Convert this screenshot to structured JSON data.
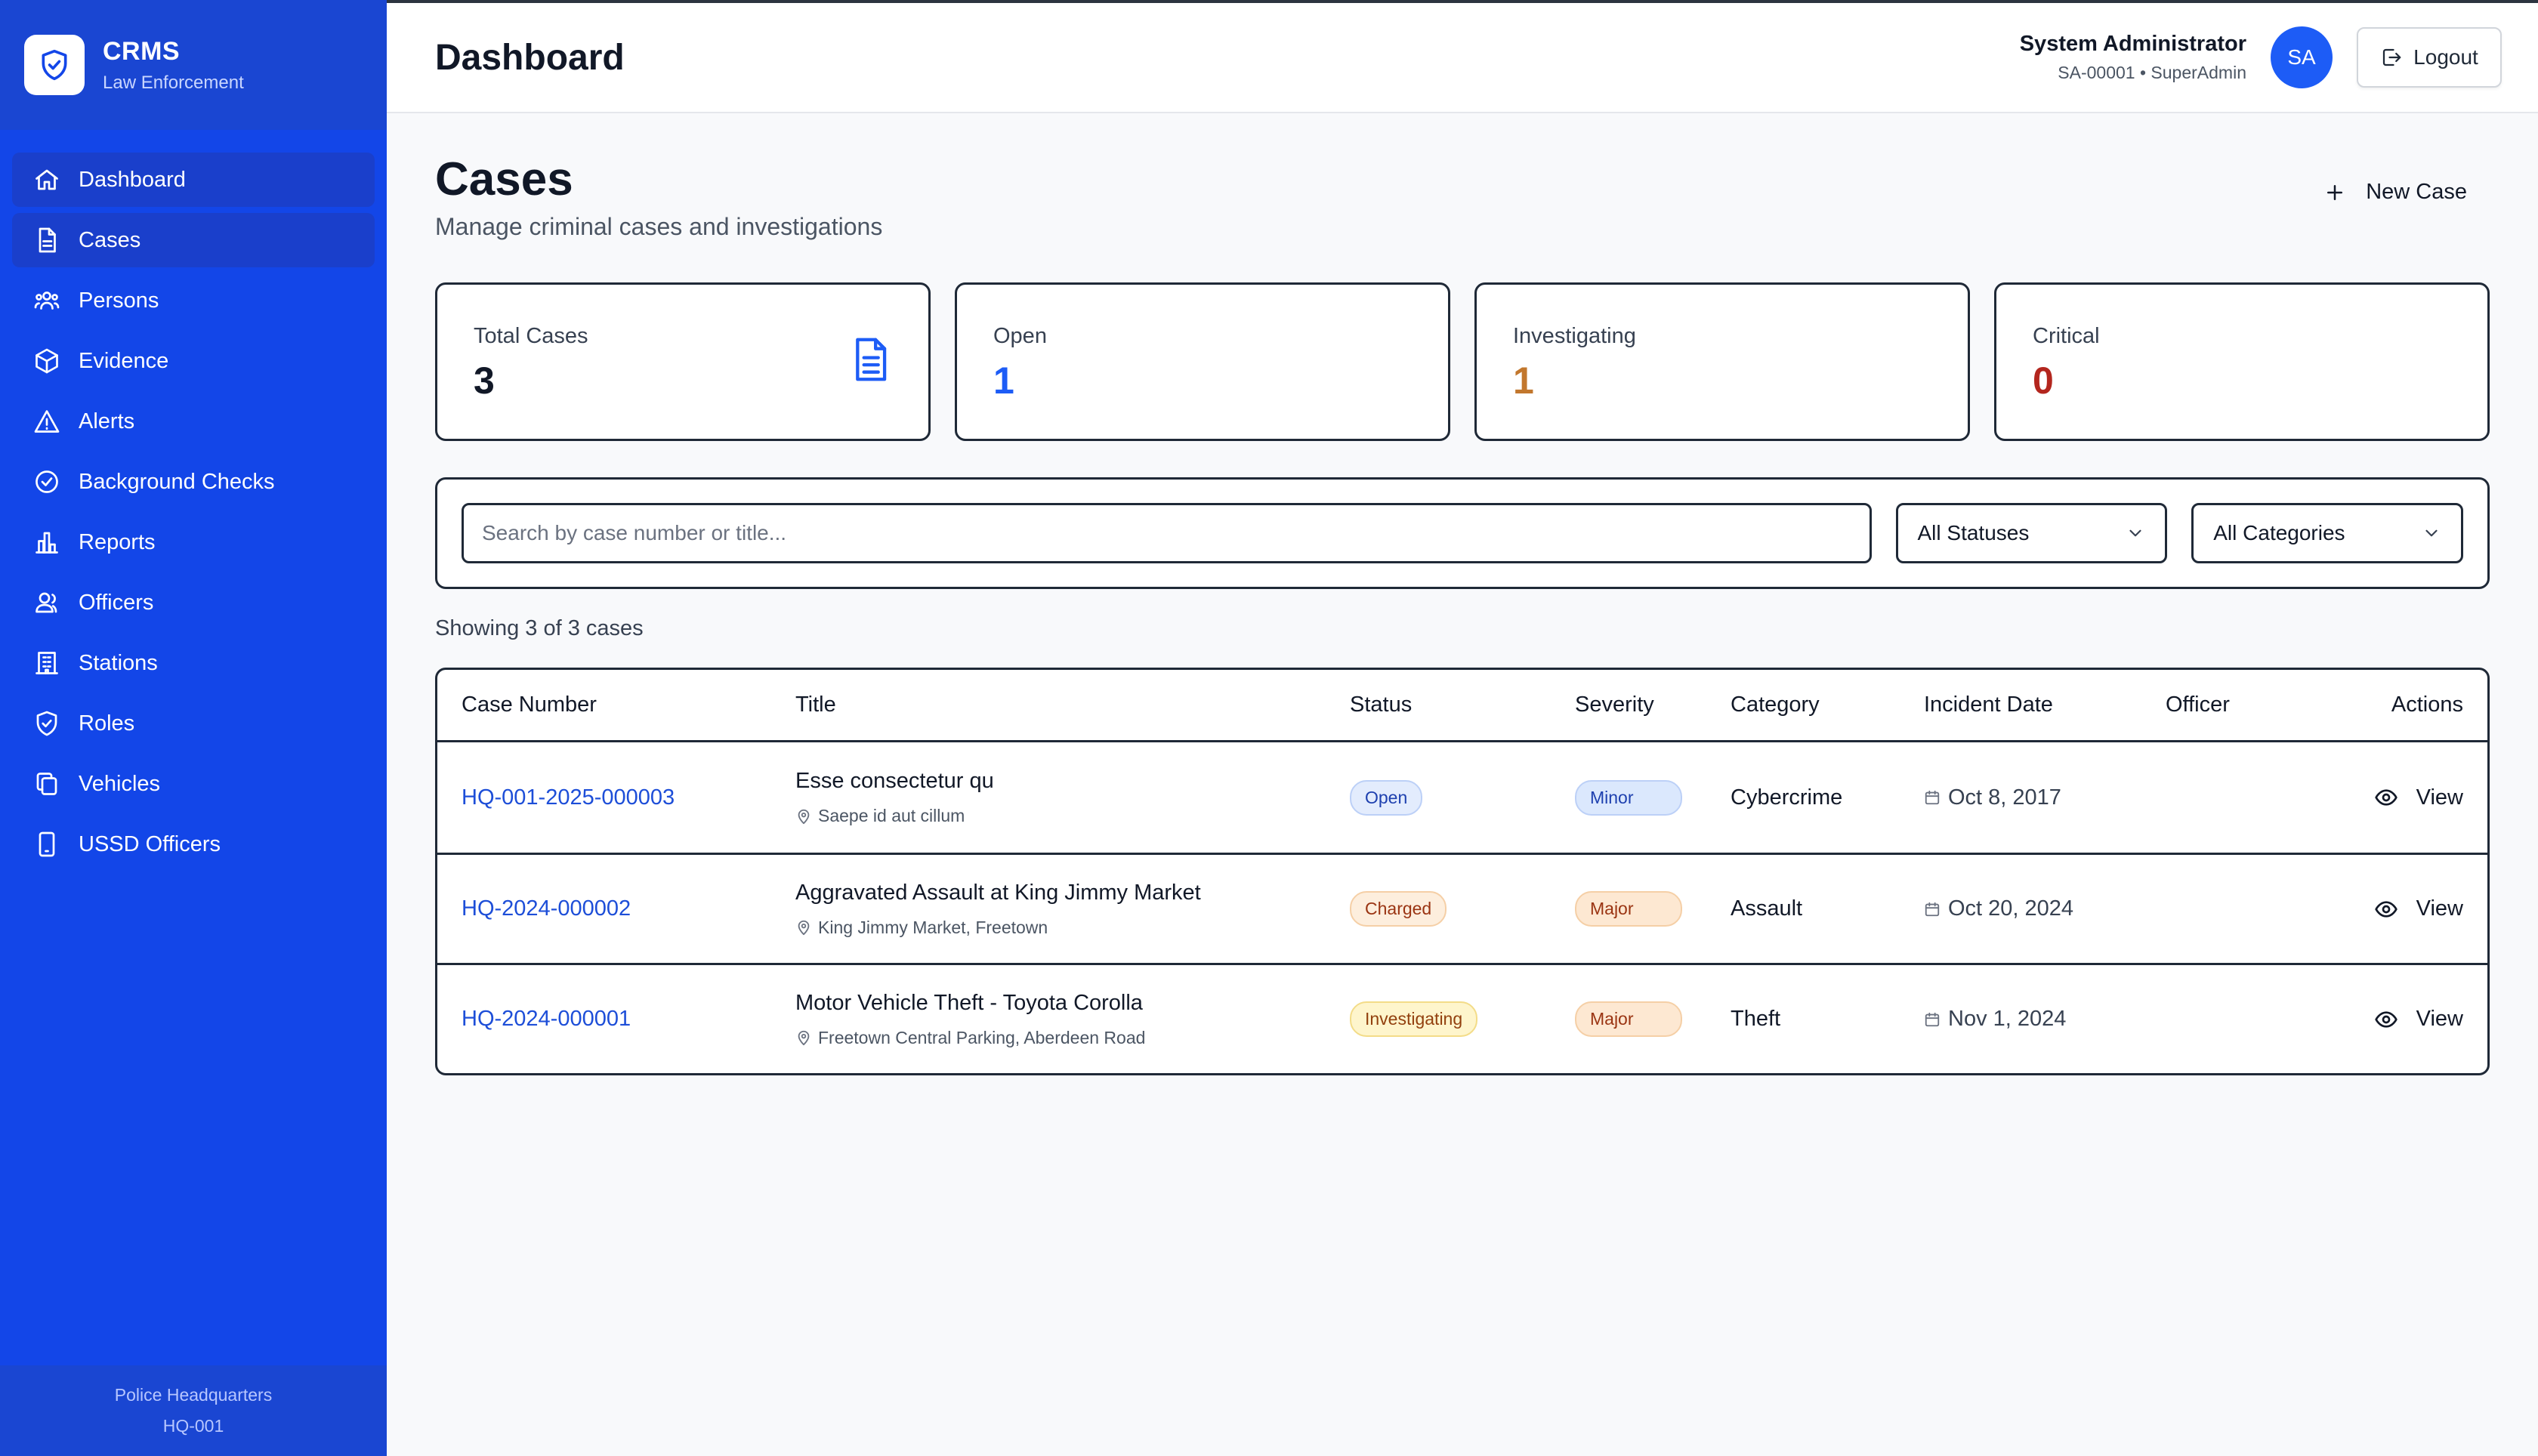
{
  "brand": {
    "title": "CRMS",
    "subtitle": "Law Enforcement",
    "logo_icon": "shield-check-icon"
  },
  "sidebar": {
    "items": [
      {
        "label": "Dashboard",
        "icon": "home-icon"
      },
      {
        "label": "Cases",
        "icon": "document-icon"
      },
      {
        "label": "Persons",
        "icon": "users-icon"
      },
      {
        "label": "Evidence",
        "icon": "cube-icon"
      },
      {
        "label": "Alerts",
        "icon": "warning-icon"
      },
      {
        "label": "Background Checks",
        "icon": "check-circle-icon"
      },
      {
        "label": "Reports",
        "icon": "bar-chart-icon"
      },
      {
        "label": "Officers",
        "icon": "officers-icon"
      },
      {
        "label": "Stations",
        "icon": "building-icon"
      },
      {
        "label": "Roles",
        "icon": "shield-icon"
      },
      {
        "label": "Vehicles",
        "icon": "copy-icon"
      },
      {
        "label": "USSD Officers",
        "icon": "phone-icon"
      }
    ],
    "active": [
      "Dashboard",
      "Cases"
    ],
    "footer": {
      "station": "Police Headquarters",
      "code": "HQ-001"
    }
  },
  "header": {
    "title": "Dashboard",
    "user_name": "System Administrator",
    "user_meta": "SA-00001 • SuperAdmin",
    "avatar_initials": "SA",
    "logout_label": "Logout"
  },
  "page": {
    "title": "Cases",
    "subtitle": "Manage criminal cases and investigations",
    "new_case_label": "New Case"
  },
  "stats": [
    {
      "label": "Total Cases",
      "value": "3",
      "color": "#111827",
      "icon": "document-icon"
    },
    {
      "label": "Open",
      "value": "1",
      "color": "#1d5cf6"
    },
    {
      "label": "Investigating",
      "value": "1",
      "color": "#c2772d"
    },
    {
      "label": "Critical",
      "value": "0",
      "color": "#b3261e"
    }
  ],
  "filters": {
    "search_placeholder": "Search by case number or title...",
    "status_selected": "All Statuses",
    "category_selected": "All Categories"
  },
  "showing_text": "Showing 3 of 3 cases",
  "table": {
    "columns": [
      "Case Number",
      "Title",
      "Status",
      "Severity",
      "Category",
      "Incident Date",
      "Officer",
      "Actions"
    ],
    "rows": [
      {
        "case_number": "HQ-001-2025-000003",
        "title": "Esse consectetur qu",
        "location": "Saepe id aut cillum",
        "status": "Open",
        "severity": "Minor",
        "category": "Cybercrime",
        "date": "Oct 8, 2017",
        "officer": "",
        "action": "View"
      },
      {
        "case_number": "HQ-2024-000002",
        "title": "Aggravated Assault at King Jimmy Market",
        "location": "King Jimmy Market, Freetown",
        "status": "Charged",
        "severity": "Major",
        "category": "Assault",
        "date": "Oct 20, 2024",
        "officer": "",
        "action": "View"
      },
      {
        "case_number": "HQ-2024-000001",
        "title": "Motor Vehicle Theft - Toyota Corolla",
        "location": "Freetown Central Parking, Aberdeen Road",
        "status": "Investigating",
        "severity": "Major",
        "category": "Theft",
        "date": "Nov 1, 2024",
        "officer": "",
        "action": "View"
      }
    ]
  },
  "colors": {
    "sidebar_bg": "#1346e8",
    "accent": "#1d5cf6",
    "link": "#1d4ed8",
    "status_open_bg": "#e3ecfd",
    "status_charged_bg": "#fdeedd",
    "status_investigating_bg": "#fef5cc",
    "severity_minor_bg": "#dbe8fd",
    "severity_major_bg": "#fde8d2"
  }
}
